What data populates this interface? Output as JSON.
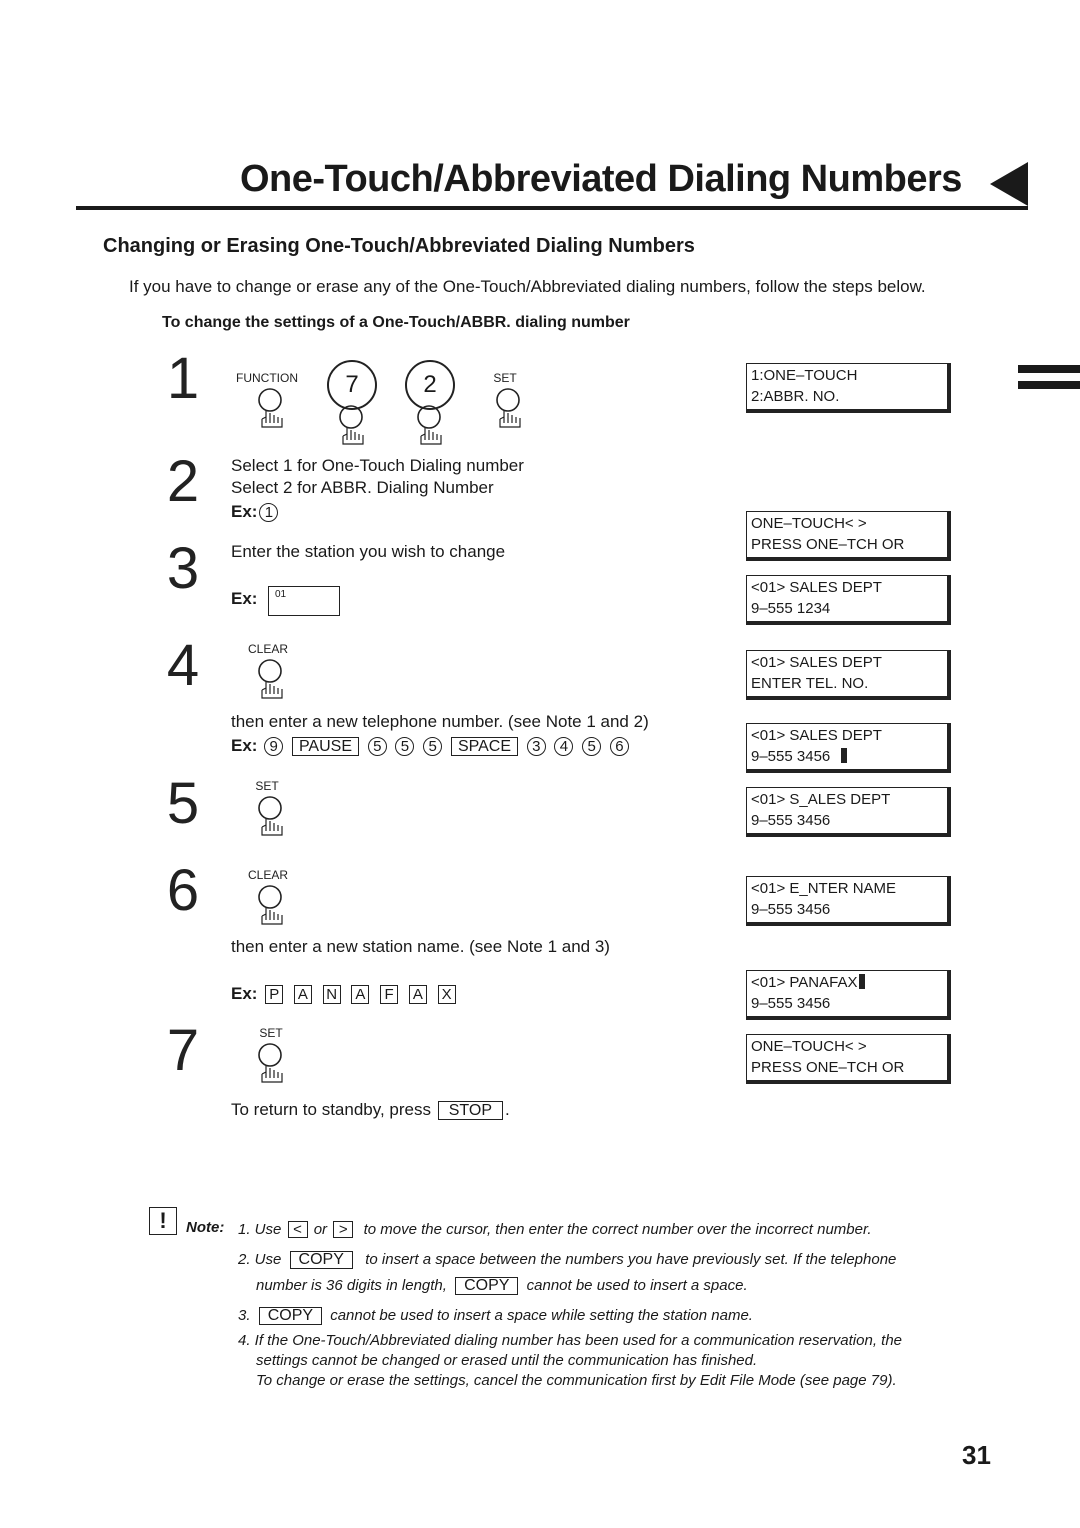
{
  "page": {
    "title": "One-Touch/Abbreviated Dialing Numbers",
    "section_heading": "Changing or Erasing One-Touch/Abbreviated Dialing Numbers",
    "intro": "If you have to change or erase any of the One-Touch/Abbreviated dialing numbers, follow the steps below.",
    "sub_heading": "To change the settings of a One-Touch/ABBR. dialing number",
    "page_number": "31"
  },
  "steps": {
    "s1": {
      "num": "1",
      "keys": {
        "function": "FUNCTION",
        "seven": "7",
        "two": "2",
        "set": "SET"
      }
    },
    "s2": {
      "num": "2",
      "line1": "Select 1 for One-Touch Dialing number",
      "line2": "Select 2 for ABBR. Dialing Number",
      "ex_label": "Ex:",
      "ex_value": "1"
    },
    "s3": {
      "num": "3",
      "text": "Enter the station you wish to change",
      "ex_label": "Ex:",
      "field_value": "01"
    },
    "s4": {
      "num": "4",
      "key": "CLEAR",
      "text": "then enter a new telephone number.  (see Note 1 and 2)",
      "ex_label": "Ex:",
      "ex_keys": [
        "9",
        "PAUSE",
        "5",
        "5",
        "5",
        "SPACE",
        "3",
        "4",
        "5",
        "6"
      ]
    },
    "s5": {
      "num": "5",
      "key": "SET"
    },
    "s6": {
      "num": "6",
      "key": "CLEAR",
      "text": "then enter a new station name.  (see Note 1 and 3)",
      "ex_label": "Ex:",
      "ex_letters": [
        "P",
        "A",
        "N",
        "A",
        "F",
        "A",
        "X"
      ]
    },
    "s7": {
      "num": "7",
      "key": "SET",
      "text_before": "To return to standby, press",
      "stop_key": "STOP",
      "text_after": "."
    }
  },
  "displays": [
    {
      "line1": "1:ONE–TOUCH",
      "line2": "2:ABBR.  NO."
    },
    {
      "line1": "ONE–TOUCH< >",
      "line2": "PRESS ONE–TCH OR"
    },
    {
      "line1": "<01> SALES DEPT",
      "line2": "9–555 1234"
    },
    {
      "line1": "<01> SALES DEPT",
      "line2": "ENTER TEL. NO."
    },
    {
      "line1": "<01> SALES DEPT",
      "line2": "9–555 3456"
    },
    {
      "line1": "<01> S_ALES DEPT",
      "line2": "9–555 3456"
    },
    {
      "line1": "<01> E_NTER NAME",
      "line2": "9–555 3456"
    },
    {
      "line1": "<01> PANAFAX",
      "line2": "9–555 3456"
    },
    {
      "line1": "ONE–TOUCH< >",
      "line2": "PRESS ONE–TCH OR"
    }
  ],
  "notes": {
    "icon": "!",
    "label": "Note:",
    "n1": {
      "pre": "1. Use",
      "k1": "<",
      "mid": "or",
      "k2": ">",
      "post": "to move the cursor, then enter the correct number over the incorrect number."
    },
    "n2": {
      "pre": "2. Use",
      "k": "COPY",
      "post": "to insert a space between the numbers you have previously set. If the telephone",
      "l2pre": "number is 36 digits in length,",
      "l2k": "COPY",
      "l2post": "cannot be used to insert a space."
    },
    "n3": {
      "pre": "3.",
      "k": "COPY",
      "post": "cannot be used to insert a space while setting the station name."
    },
    "n4": {
      "l1": "4. If the One-Touch/Abbreviated dialing number has been used for a communication reservation, the",
      "l2": "settings cannot be changed or erased until the communication has finished.",
      "l3": "To change or erase the settings, cancel the communication first by Edit File Mode (see page 79)."
    }
  }
}
